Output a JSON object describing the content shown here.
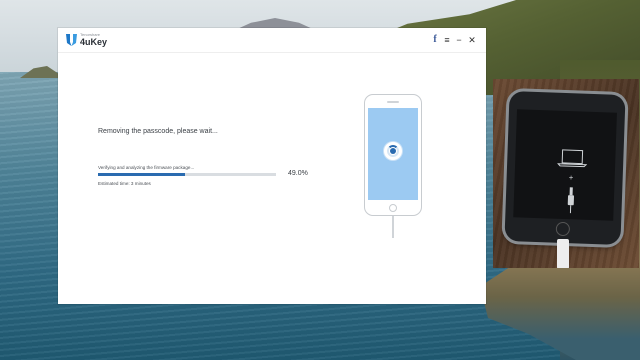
{
  "app": {
    "brand_small": "Tenorshare",
    "brand_name": "4uKey"
  },
  "window_controls": {
    "facebook_icon": "facebook-icon",
    "menu_icon": "menu-icon",
    "minimize_icon": "minimize-icon",
    "close_icon": "close-icon",
    "facebook": "f",
    "menu": "≡",
    "minimize": "−",
    "close": "✕"
  },
  "main": {
    "status_title": "Removing the passcode, please wait...",
    "progress_label": "Verifying and analyzing the firmware package...",
    "progress_value": 0.49,
    "progress_percent": "49.0%",
    "estimated_time": "Estimated time: 3 minutes"
  },
  "colors": {
    "accent": "#2a6bb0",
    "phone_screen": "#9ccaf2"
  }
}
